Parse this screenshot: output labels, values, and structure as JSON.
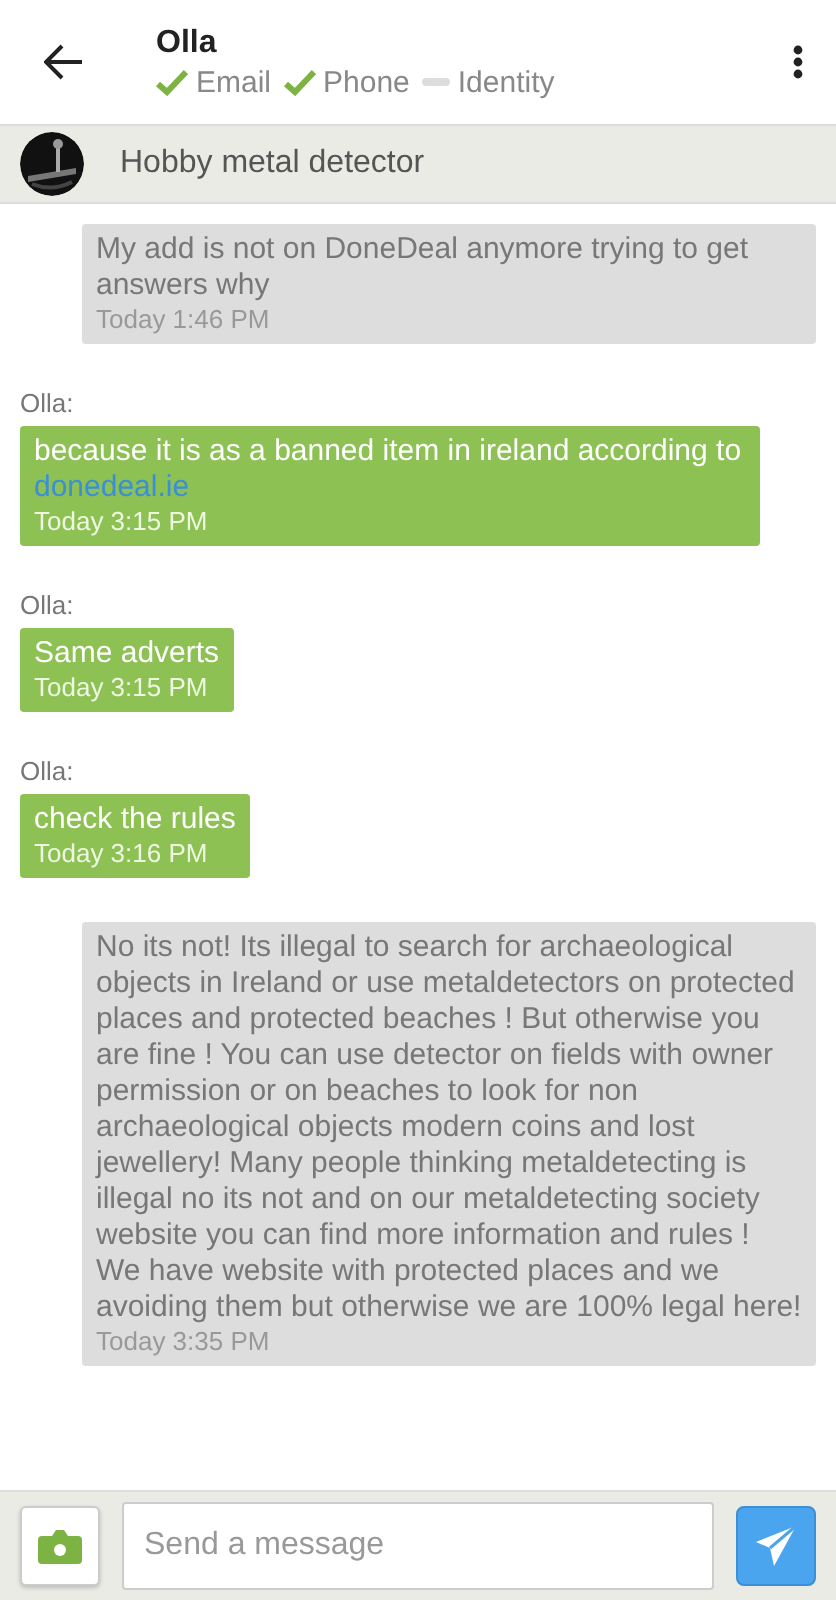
{
  "header": {
    "title": "Olla",
    "verifications": [
      {
        "label": "Email",
        "verified": true
      },
      {
        "label": "Phone",
        "verified": true
      },
      {
        "label": "Identity",
        "verified": false
      }
    ]
  },
  "item": {
    "title": "Hobby metal detector"
  },
  "messages": [
    {
      "kind": "sent",
      "text": "My add is not on DoneDeal anymore trying to get answers why",
      "time": "Today 1:46 PM"
    },
    {
      "kind": "received",
      "sender": "Olla:",
      "text": "because it is as a banned item in ireland according to",
      "link": "donedeal.ie",
      "time": "Today 3:15 PM"
    },
    {
      "kind": "received",
      "sender": "Olla:",
      "text": "Same adverts",
      "time": "Today 3:15 PM"
    },
    {
      "kind": "received",
      "sender": "Olla:",
      "text": "check the rules",
      "time": "Today 3:16 PM"
    },
    {
      "kind": "sent",
      "text": "No its not! Its illegal to search for archaeological objects in Ireland or use metaldetectors on protected places and protected beaches ! But otherwise you are fine ! You can use detector on fields with owner permission or on beaches to look for non archaeological objects modern coins and lost jewellery! Many people thinking metaldetecting is illegal no its not and on our metaldetecting society website you can find more information and rules ! We have website with protected places and we avoiding them but otherwise we are 100% legal here!",
      "time": "Today 3:35 PM"
    }
  ],
  "composer": {
    "placeholder": "Send a message"
  }
}
